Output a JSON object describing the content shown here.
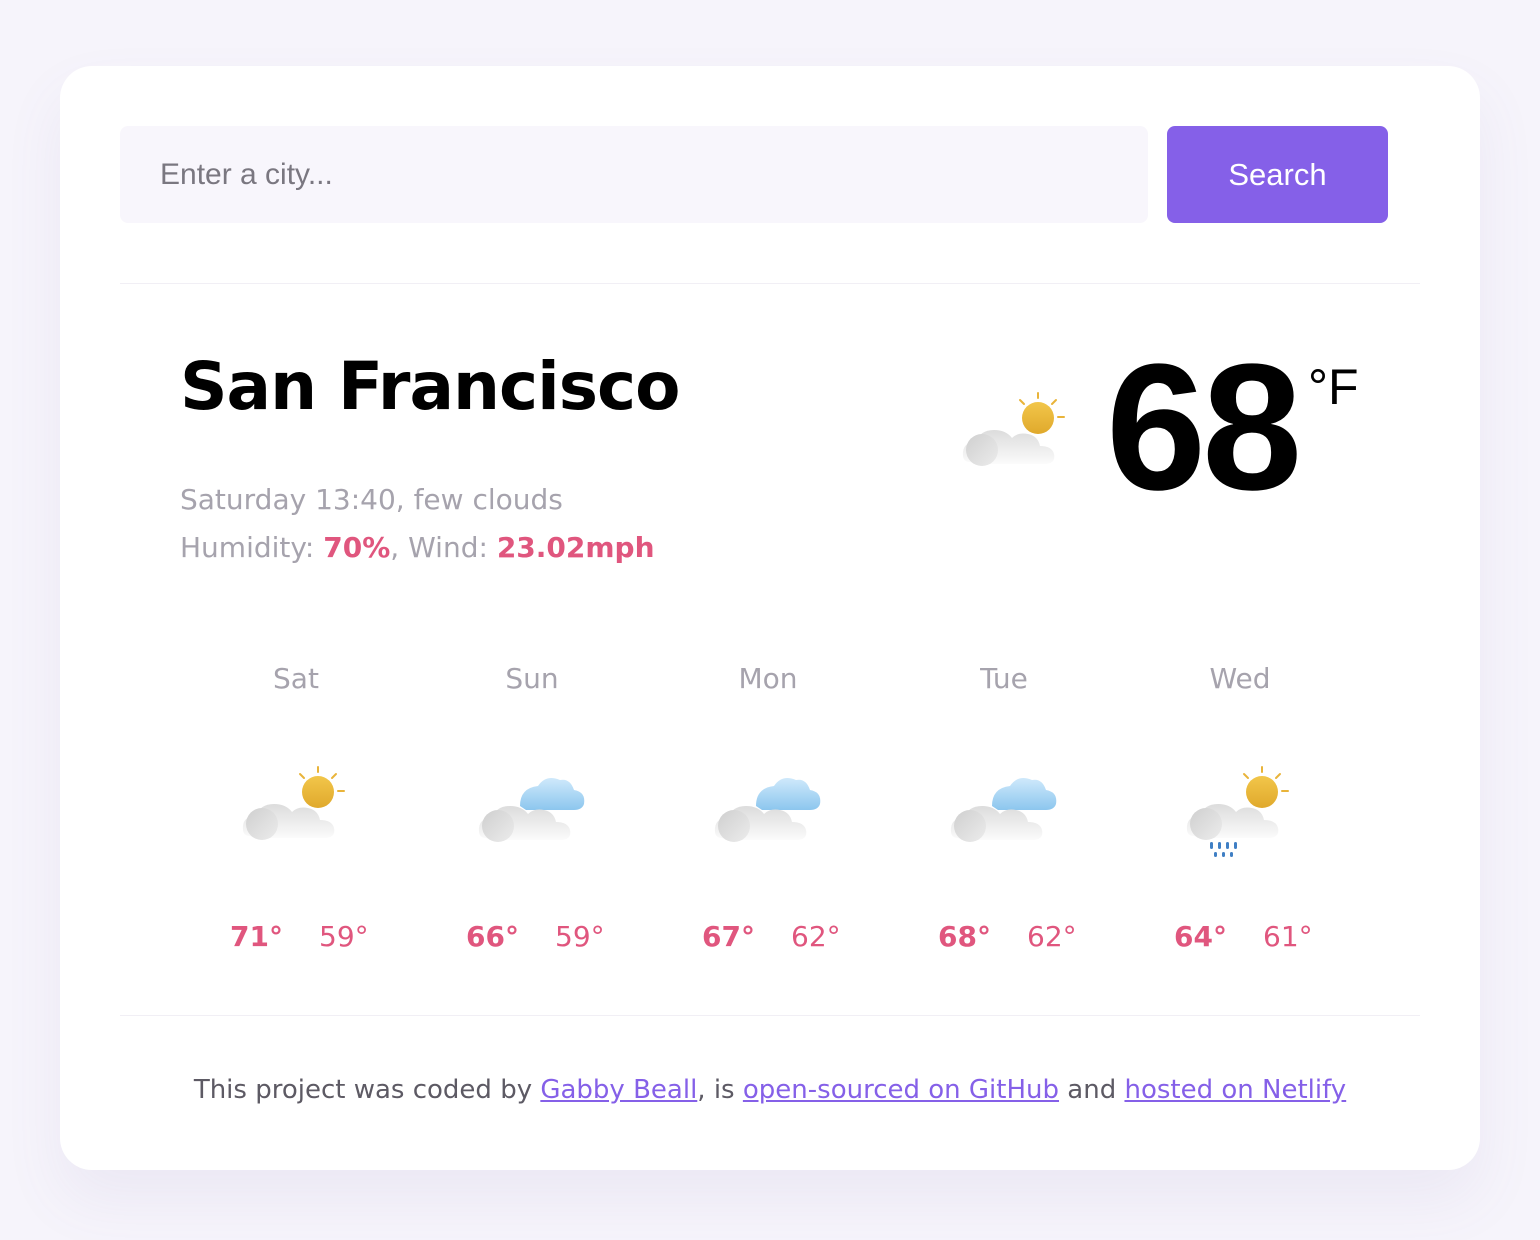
{
  "search": {
    "placeholder": "Enter a city...",
    "value": "",
    "button_label": "Search"
  },
  "current": {
    "city": "San Francisco",
    "datetime_desc": "Saturday 13:40, few clouds",
    "humidity_label": "Humidity: ",
    "humidity_value": "70%",
    "wind_label": ", Wind: ",
    "wind_value": "23.02mph",
    "icon": "few-clouds-icon",
    "temperature": "68",
    "unit": "°F"
  },
  "forecast": [
    {
      "day": "Sat",
      "icon": "few-clouds-icon",
      "max": "71°",
      "min": "59°"
    },
    {
      "day": "Sun",
      "icon": "broken-clouds-icon",
      "max": "66°",
      "min": "59°"
    },
    {
      "day": "Mon",
      "icon": "broken-clouds-icon",
      "max": "67°",
      "min": "62°"
    },
    {
      "day": "Tue",
      "icon": "broken-clouds-icon",
      "max": "68°",
      "min": "62°"
    },
    {
      "day": "Wed",
      "icon": "rain-sun-icon",
      "max": "64°",
      "min": "61°"
    }
  ],
  "footer": {
    "prefix": "This project was coded by ",
    "author_link": "Gabby Beall",
    "middle1": ", is ",
    "github_link": "open-sourced on GitHub",
    "middle2": " and ",
    "netlify_link": "hosted on Netlify"
  },
  "colors": {
    "accent": "#8560e8",
    "highlight": "#e0567e",
    "muted": "#a6a3ad",
    "background": "#f6f4fb"
  }
}
